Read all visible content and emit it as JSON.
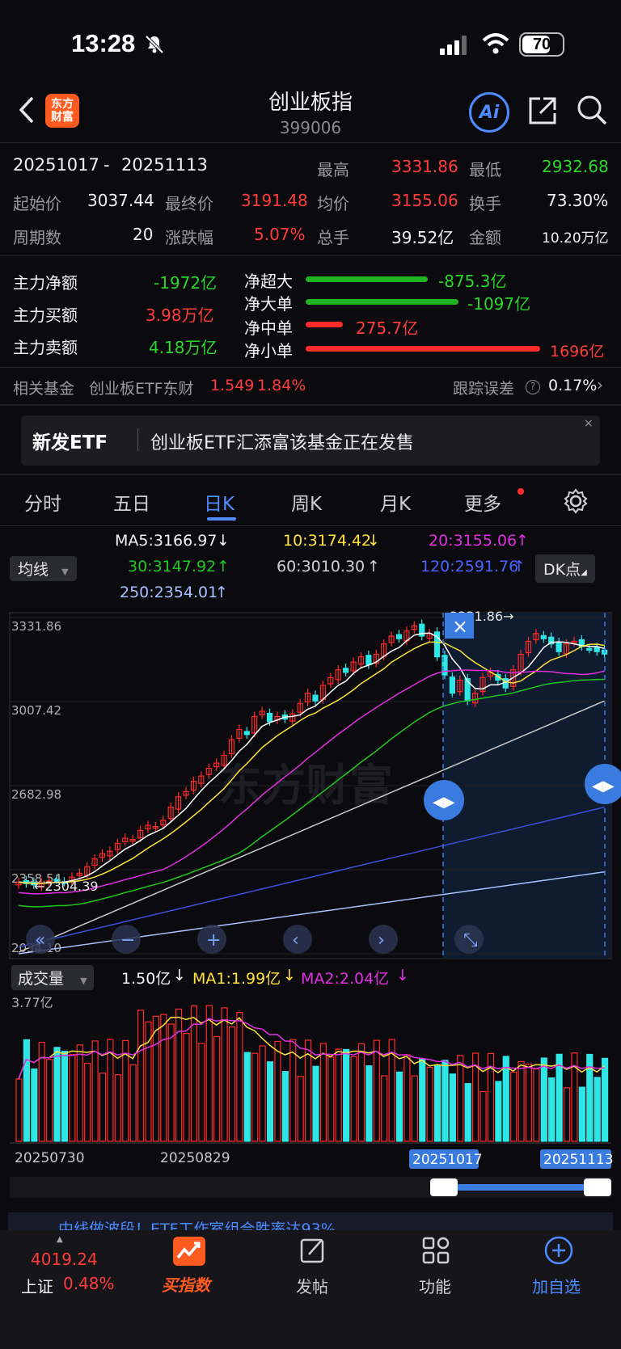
{
  "status_bar": {
    "time": "13:28",
    "battery": "70"
  },
  "header": {
    "logo_text_1": "东方",
    "logo_text_2": "财富",
    "title": "创业板指",
    "code": "399006",
    "ai_label": "Ai"
  },
  "stats": {
    "date_range_start": "20251017",
    "date_range_sep": "-",
    "date_range_end": "20251113",
    "high_label": "最高",
    "high_value": "3331.86",
    "low_label": "最低",
    "low_value": "2932.68",
    "open_label": "起始价",
    "open_value": "3037.44",
    "close_label": "最终价",
    "close_value": "3191.48",
    "avg_label": "均价",
    "avg_value": "3155.06",
    "turnover_label": "换手",
    "turnover_value": "73.30%",
    "periods_label": "周期数",
    "periods_value": "20",
    "change_label": "涨跌幅",
    "change_value": "5.07%",
    "volume_label": "总手",
    "volume_value": "39.52亿",
    "amount_label": "金额",
    "amount_value": "10.20万亿"
  },
  "fund_flow": {
    "net_label": "主力净额",
    "net_value": "-1972亿",
    "buy_label": "主力买额",
    "buy_value": "3.98万亿",
    "sell_label": "主力卖额",
    "sell_value": "4.18万亿",
    "rows": [
      {
        "label": "净超大",
        "value": "-875.3亿",
        "color": "#1fb31f",
        "fraction": 0.52
      },
      {
        "label": "净大单",
        "value": "-1097亿",
        "color": "#1fb31f",
        "fraction": 0.65
      },
      {
        "label": "净中单",
        "value": "275.7亿",
        "color": "#ff2a2a",
        "fraction": 0.16
      },
      {
        "label": "净小单",
        "value": "1696亿",
        "color": "#ff2a2a",
        "fraction": 1.0
      }
    ]
  },
  "related_fund": {
    "label": "相关基金",
    "name": "创业板ETF东财",
    "price": "1.549",
    "change": "1.84%",
    "tracking_label": "跟踪误差",
    "tracking_value": "0.17%"
  },
  "banner": {
    "tag": "新发ETF",
    "text": "创业板ETF汇添富该基金正在发售",
    "close": "×"
  },
  "tabs": [
    "分时",
    "五日",
    "日K",
    "周K",
    "月K",
    "更多"
  ],
  "ma": {
    "selector": "均线",
    "ma5": "MA5:3166.97",
    "ma10": "10:3174.42",
    "ma20": "20:3155.06",
    "ma30": "30:3147.92",
    "ma60": "60:3010.30",
    "ma120": "120:2591.76",
    "ma250": "250:2354.01",
    "dk": "DK点"
  },
  "colors": {
    "up": "#ff2a2a",
    "down": "#2ee6e6",
    "ma5": "#ffffff",
    "ma10": "#ffe23a",
    "ma20": "#e02ee0",
    "ma30": "#1fc81f",
    "ma60": "#c8c8c8",
    "ma120": "#3c50d8",
    "ma250": "#a8c0ff",
    "accent": "#4d8bff"
  },
  "chart_data": [
    {
      "type": "candlestick",
      "y_ticks": [
        "3331.86",
        "3007.42",
        "2682.98",
        "2358.54",
        "2034.10"
      ],
      "ylim": [
        2034.1,
        3331.86
      ],
      "x_ticks": [
        "20250730",
        "20250829",
        "20251017",
        "20251113"
      ],
      "high_marker": "3331.86",
      "low_marker": "2304.39",
      "watermark": "东方财富",
      "closes": [
        2310,
        2305,
        2300,
        2308,
        2315,
        2320,
        2310,
        2330,
        2345,
        2370,
        2400,
        2420,
        2430,
        2460,
        2480,
        2475,
        2510,
        2530,
        2525,
        2550,
        2600,
        2640,
        2660,
        2700,
        2720,
        2750,
        2770,
        2800,
        2860,
        2900,
        2880,
        2950,
        2970,
        2930,
        2950,
        2940,
        2960,
        3000,
        3040,
        3010,
        3070,
        3100,
        3130,
        3120,
        3160,
        3180,
        3150,
        3190,
        3230,
        3260,
        3250,
        3280,
        3300,
        3260,
        3270,
        3180,
        3110,
        3040,
        3090,
        3010,
        3040,
        3100,
        3120,
        3090,
        3060,
        3130,
        3190,
        3240,
        3270,
        3250,
        3230,
        3200,
        3230,
        3240,
        3220,
        3210,
        3200,
        3191
      ]
    },
    {
      "type": "bar",
      "label": "成交量",
      "volume": "1.50亿",
      "ma1": "MA1:1.99亿",
      "ma2": "MA2:2.04亿",
      "y_max_label": "3.77亿"
    }
  ],
  "nav_buttons": [
    "«",
    "−",
    "+",
    "‹",
    "›",
    "⤡"
  ],
  "bottom_banner": "中线做波段！ETF工作室组合胜率达93%",
  "bottom_bar": {
    "index_name": "上证",
    "index_value": "4019.24",
    "index_change": "0.48%",
    "buy_label": "买指数",
    "post_label": "发帖",
    "func_label": "功能",
    "add_label": "加自选"
  }
}
